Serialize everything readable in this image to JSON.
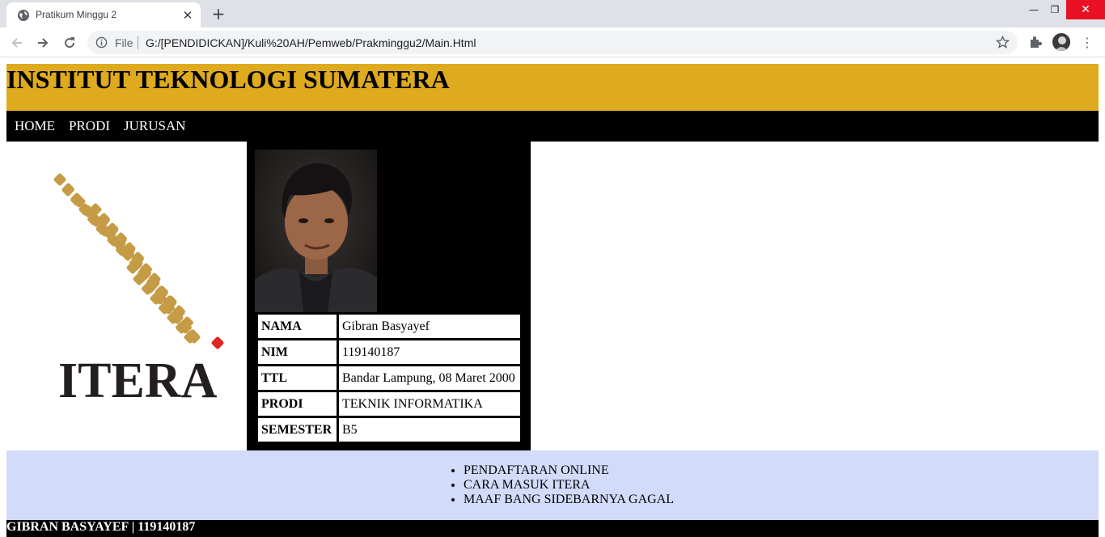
{
  "browser": {
    "tab_title": "Pratikum Minggu 2",
    "tab_close": "✕",
    "new_tab": "+",
    "window_controls": {
      "minimize": "—",
      "maximize": "❐",
      "close": "✕"
    },
    "url_scheme": "File",
    "url": "G:/[PENDIDICKAN]/Kuli%20AH/Pemweb/Prakminggu2/Main.Html",
    "menu": "⋮"
  },
  "page": {
    "header_title": "INSTITUT TEKNOLOGI SUMATERA",
    "header_color": "#deaa1e",
    "nav": [
      {
        "label": "HOME"
      },
      {
        "label": "PRODI"
      },
      {
        "label": "JURUSAN"
      }
    ],
    "logo_text": "ITERA",
    "logo_colors": {
      "tiles": "#c69b46",
      "accent": "#e02420",
      "text": "#231f20"
    },
    "profile": [
      {
        "key": "NAMA",
        "value": "Gibran Basyayef"
      },
      {
        "key": "NIM",
        "value": "119140187"
      },
      {
        "key": "TTL",
        "value": "Bandar Lampung, 08 Maret 2000"
      },
      {
        "key": "PRODI",
        "value": "TEKNIK INFORMATIKA"
      },
      {
        "key": "SEMESTER",
        "value": "B5"
      }
    ],
    "sidebar_items": [
      "PENDAFTARAN ONLINE",
      "CARA MASUK ITERA",
      "MAAF BANG SIDEBARNYA GAGAL"
    ],
    "sidebar_color": "#d3dbfb",
    "footer_text": "GIBRAN BASYAYEF | 119140187"
  }
}
